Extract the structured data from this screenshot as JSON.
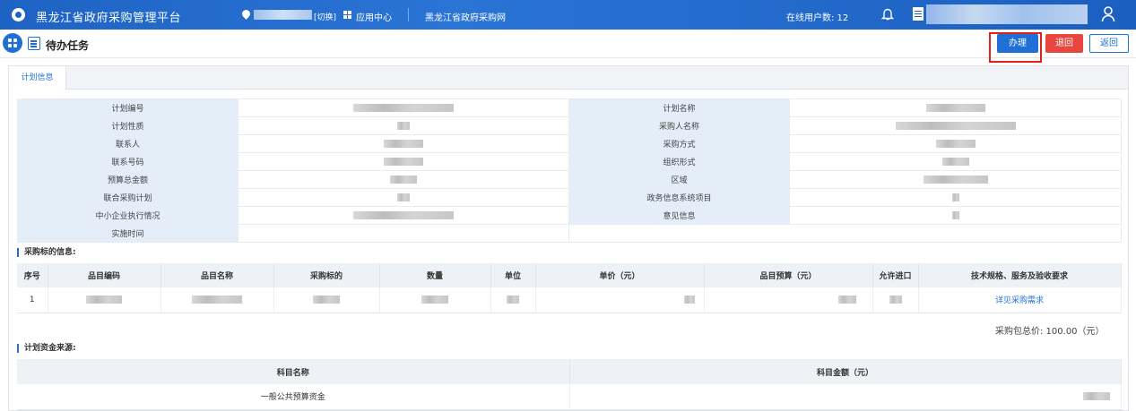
{
  "topbar": {
    "app_title": "黑龙江省政府采购管理平台",
    "location_suffix": "[切换]",
    "app_center": "应用中心",
    "gov_link": "黑龙江省政府采购网",
    "online_label": "在线用户数: 12"
  },
  "header": {
    "page_title": "待办任务",
    "handle_label": "办理",
    "reject_label": "退回",
    "back_label": "返回"
  },
  "tabs": [
    "计划信息"
  ],
  "plan_info": {
    "rows": [
      {
        "left": "计划编号",
        "right": "计划名称"
      },
      {
        "left": "计划性质",
        "right": "采购人名称"
      },
      {
        "left": "联系人",
        "right": "采购方式"
      },
      {
        "left": "联系号码",
        "right": "组织形式"
      },
      {
        "left": "预算总金额",
        "right": "区域"
      },
      {
        "left": "联合采购计划",
        "right": "政务信息系统项目"
      },
      {
        "left": "中小企业执行情况",
        "right": "意见信息"
      },
      {
        "left": "实施时间",
        "right": ""
      }
    ]
  },
  "procurement": {
    "section_title": "采购标的信息:",
    "columns": [
      "序号",
      "品目编码",
      "品目名称",
      "采购标的",
      "数量",
      "单位",
      "单价（元）",
      "品目预算（元）",
      "允许进口",
      "技术规格、服务及验收要求"
    ],
    "rows": [
      {
        "index": "1",
        "detail_link": "详见采购需求"
      }
    ],
    "total": "采购包总价: 100.00（元）"
  },
  "funds": {
    "section_title": "计划资金来源:",
    "columns": [
      "科目名称",
      "科目金额（元）"
    ],
    "rows": [
      {
        "name": "一般公共预算资金"
      }
    ]
  }
}
